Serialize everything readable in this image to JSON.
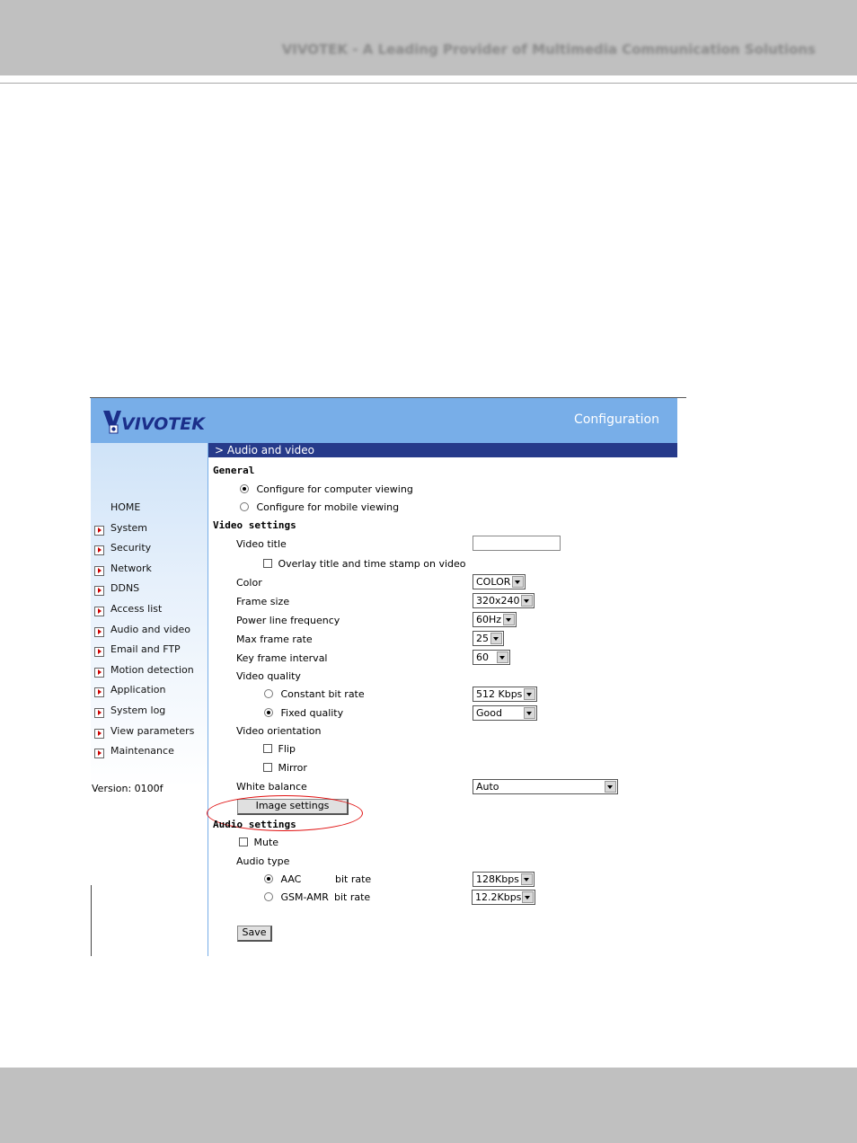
{
  "page": {
    "tagline": "VIVOTEK - A Leading Provider of Multimedia Communication Solutions"
  },
  "app": {
    "logo_text": "VIVOTEK",
    "config_title": "Configuration",
    "section_title": "> Audio and video",
    "version": "Version: 0100f",
    "accent_color": "#263a8a",
    "banner_color": "#78aee8"
  },
  "sidebar": {
    "home": "HOME",
    "items": [
      {
        "label": "System"
      },
      {
        "label": "Security"
      },
      {
        "label": "Network"
      },
      {
        "label": "DDNS"
      },
      {
        "label": "Access list"
      },
      {
        "label": "Audio and video"
      },
      {
        "label": "Email and FTP"
      },
      {
        "label": "Motion detection"
      },
      {
        "label": "Application"
      },
      {
        "label": "System log"
      },
      {
        "label": "View parameters"
      },
      {
        "label": "Maintenance"
      }
    ]
  },
  "general": {
    "heading": "General",
    "opt_computer": "Configure for computer viewing",
    "opt_mobile": "Configure for mobile viewing",
    "selected": "computer"
  },
  "video": {
    "heading": "Video settings",
    "title_label": "Video title",
    "title_value": "",
    "overlay_label": "Overlay title and time stamp on video",
    "color_label": "Color",
    "color_value": "COLOR",
    "frame_size_label": "Frame size",
    "frame_size_value": "320x240",
    "power_label": "Power line frequency",
    "power_value": "60Hz",
    "max_rate_label": "Max frame rate",
    "max_rate_value": "25",
    "key_interval_label": "Key frame interval",
    "key_interval_value": "60",
    "quality_label": "Video quality",
    "cbr_label": "Constant bit rate",
    "cbr_value": "512 Kbps",
    "fixed_label": "Fixed quality",
    "fixed_value": "Good",
    "orientation_label": "Video orientation",
    "flip_label": "Flip",
    "mirror_label": "Mirror",
    "wb_label": "White balance",
    "wb_value": "Auto",
    "image_settings_btn": "Image settings"
  },
  "audio": {
    "heading": "Audio settings",
    "mute_label": "Mute",
    "type_label": "Audio type",
    "aac_label": "AAC",
    "aac_bitrate_label": "bit rate",
    "aac_bitrate_value": "128Kbps",
    "gsm_label": "GSM-AMR",
    "gsm_bitrate_label": "bit rate",
    "gsm_bitrate_value": "12.2Kbps",
    "save_btn": "Save"
  }
}
